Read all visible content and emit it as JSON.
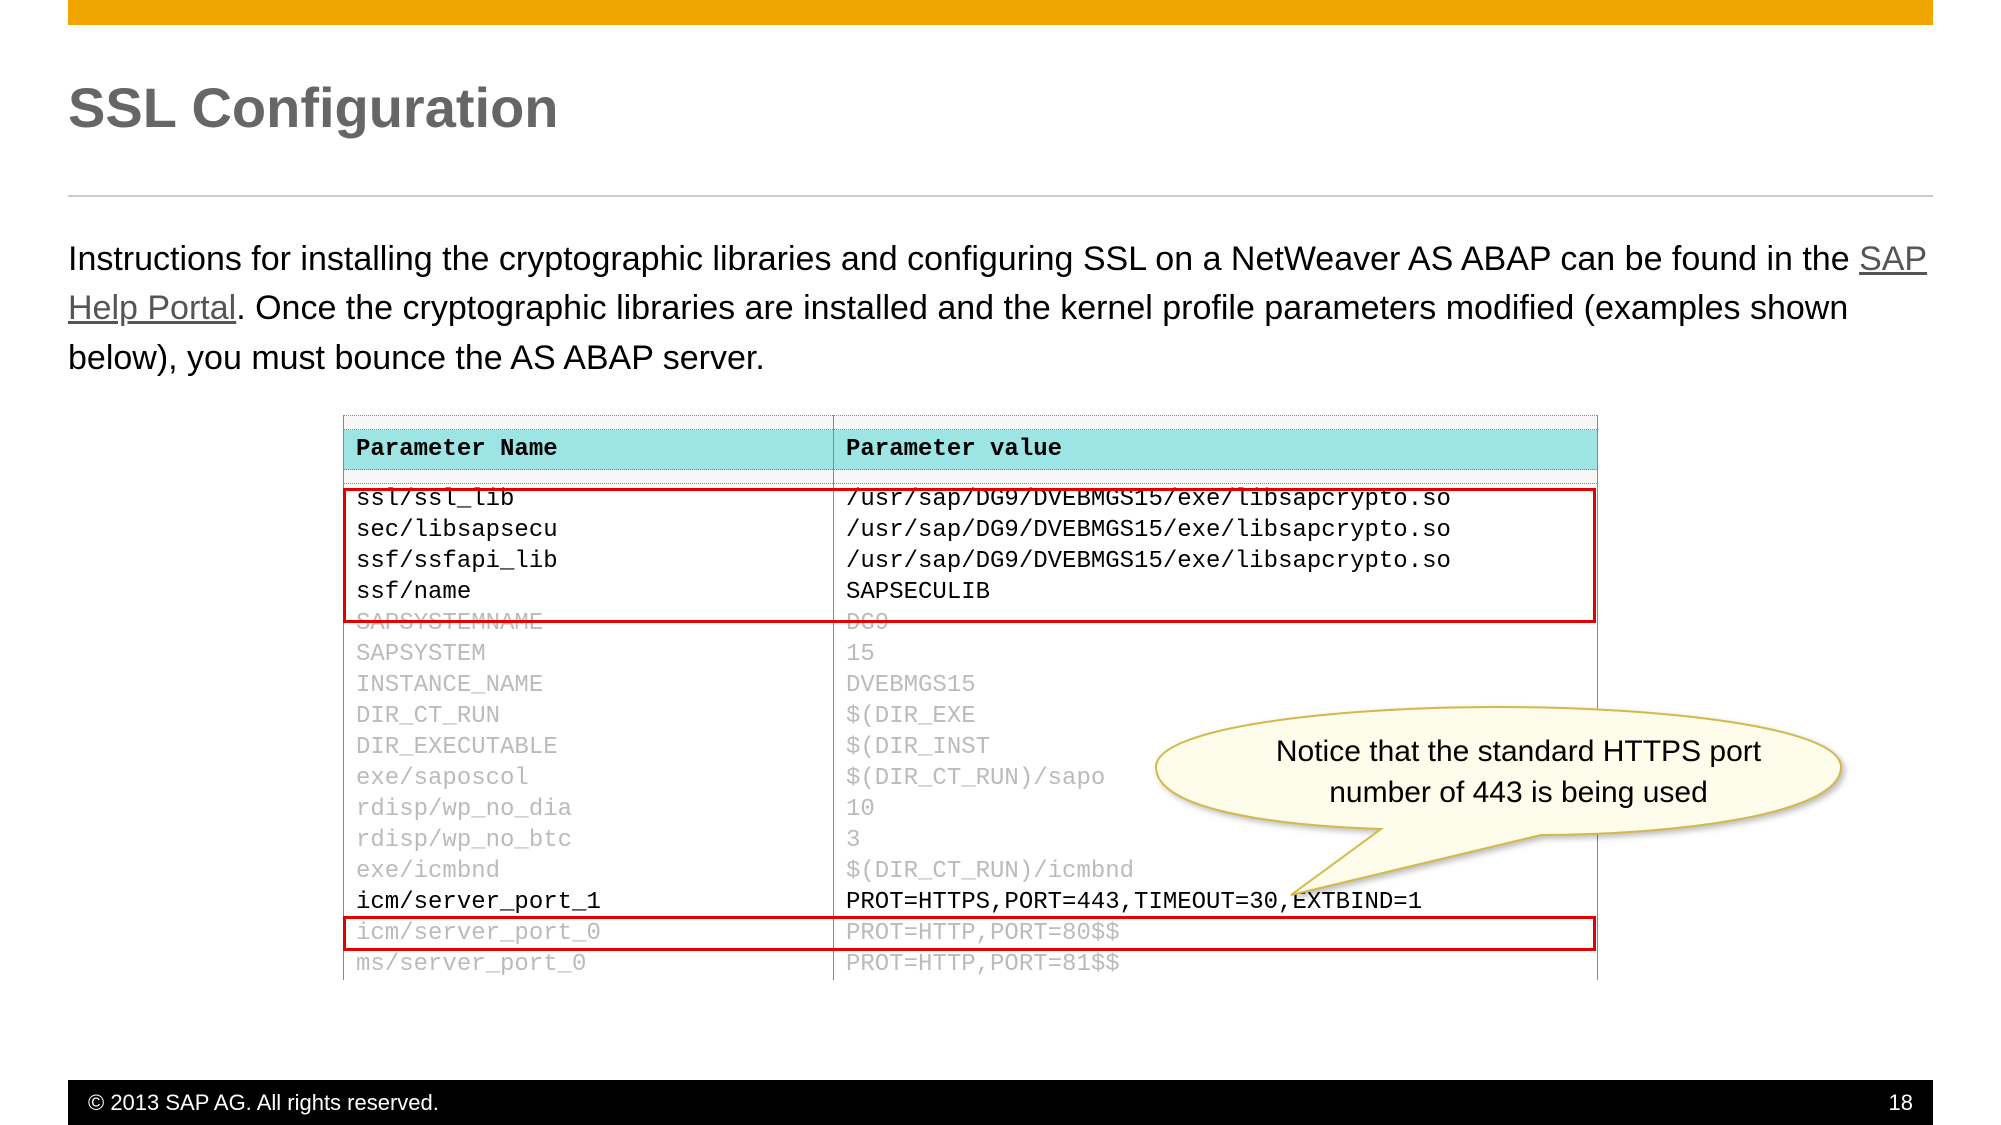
{
  "page": {
    "title": "SSL Configuration",
    "description_pre": "Instructions for installing the cryptographic libraries and configuring SSL on a NetWeaver AS ABAP can be found in the ",
    "link_text": "SAP Help Portal",
    "description_post": ".  Once the cryptographic libraries are installed and the kernel profile parameters modified (examples shown below), you must bounce the AS ABAP server."
  },
  "table": {
    "header_name": "Parameter Name",
    "header_value": "Parameter value",
    "rows": [
      {
        "name": "ssl/ssl_lib",
        "value": "/usr/sap/DG9/DVEBMGS15/exe/libsapcrypto.so",
        "style": "data"
      },
      {
        "name": "sec/libsapsecu",
        "value": "/usr/sap/DG9/DVEBMGS15/exe/libsapcrypto.so",
        "style": "data"
      },
      {
        "name": "ssf/ssfapi_lib",
        "value": "/usr/sap/DG9/DVEBMGS15/exe/libsapcrypto.so",
        "style": "data"
      },
      {
        "name": "ssf/name",
        "value": "SAPSECULIB",
        "style": "data"
      },
      {
        "name": "SAPSYSTEMNAME",
        "value": "DG9",
        "style": "gray"
      },
      {
        "name": "SAPSYSTEM",
        "value": "15",
        "style": "gray"
      },
      {
        "name": "INSTANCE_NAME",
        "value": "DVEBMGS15",
        "style": "gray"
      },
      {
        "name": "DIR_CT_RUN",
        "value": "$(DIR_EXE",
        "style": "gray"
      },
      {
        "name": "DIR_EXECUTABLE",
        "value": "$(DIR_INST",
        "style": "gray"
      },
      {
        "name": "exe/saposcol",
        "value": "$(DIR_CT_RUN)/sapo",
        "style": "gray"
      },
      {
        "name": "rdisp/wp_no_dia",
        "value": "10",
        "style": "gray"
      },
      {
        "name": "rdisp/wp_no_btc",
        "value": "3",
        "style": "gray"
      },
      {
        "name": "exe/icmbnd",
        "value": "$(DIR_CT_RUN)/icmbnd",
        "style": "gray"
      },
      {
        "name": "icm/server_port_1",
        "value": "PROT=HTTPS,PORT=443,TIMEOUT=30,EXTBIND=1",
        "style": "data"
      },
      {
        "name": "icm/server_port_0",
        "value": "PROT=HTTP,PORT=80$$",
        "style": "gray"
      },
      {
        "name": "ms/server_port_0",
        "value": "PROT=HTTP,PORT=81$$",
        "style": "gray"
      }
    ]
  },
  "callout": {
    "text": "Notice that the standard HTTPS port number of 443 is being used"
  },
  "footer": {
    "copyright": "©  2013 SAP AG. All rights reserved.",
    "page_number": "18"
  }
}
